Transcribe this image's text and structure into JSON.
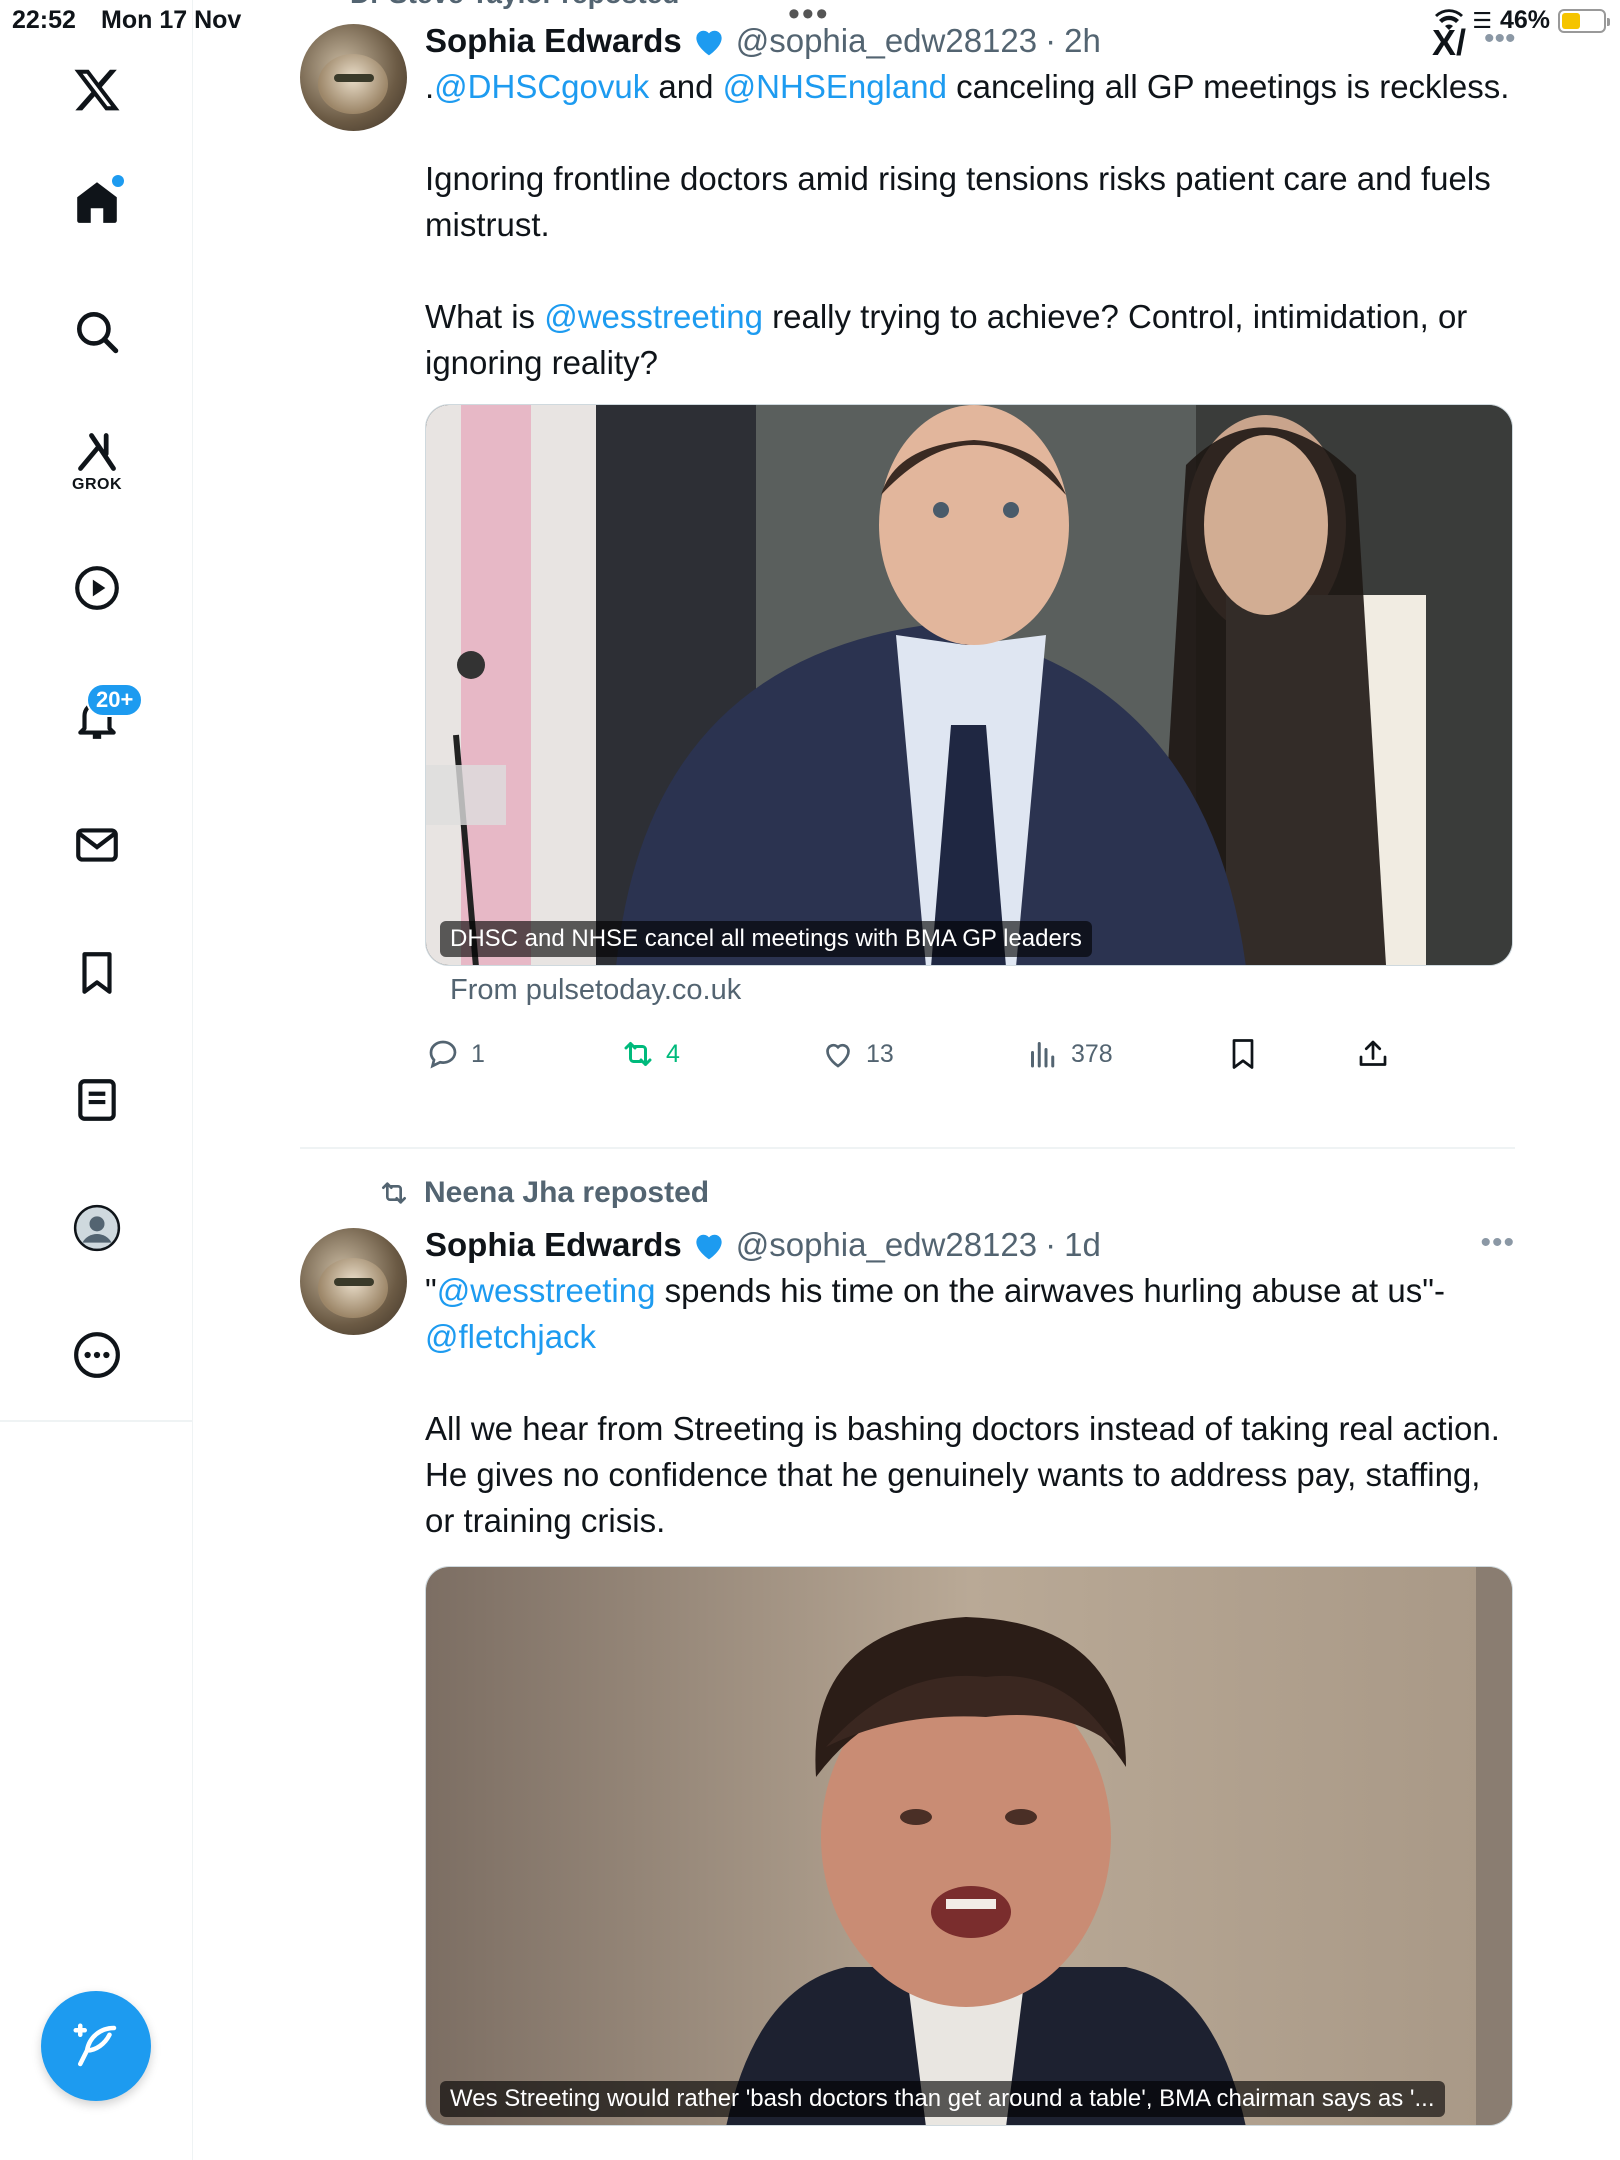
{
  "status_bar": {
    "time": "22:52",
    "date": "Mon 17 Nov",
    "battery": "46%",
    "battery_level": 0.46
  },
  "sidebar": {
    "items": [
      {
        "name": "x-logo",
        "label": ""
      },
      {
        "name": "home",
        "label": ""
      },
      {
        "name": "search",
        "label": ""
      },
      {
        "name": "grok",
        "label": "GROK"
      },
      {
        "name": "video",
        "label": ""
      },
      {
        "name": "notifications",
        "label": ""
      },
      {
        "name": "messages",
        "label": ""
      },
      {
        "name": "bookmarks",
        "label": ""
      },
      {
        "name": "lists",
        "label": ""
      },
      {
        "name": "profile",
        "label": ""
      },
      {
        "name": "more",
        "label": ""
      }
    ],
    "notification_badge": "20+"
  },
  "feed": {
    "top_repost": "Dr Steve Taylor reposted",
    "tweets": [
      {
        "author": "Sophia Edwards",
        "handle": "@sophia_edw28123",
        "time": "2h",
        "text": {
          "p1_prefix": ".",
          "p1_mention1": "@DHSCgovuk",
          "p1_and": " and ",
          "p1_mention2": "@NHSEngland",
          "p1_rest": " canceling all GP meetings is reckless.",
          "p2": "Ignoring frontline doctors amid rising tensions risks patient care and fuels mistrust.",
          "p3_prefix": "What is ",
          "p3_mention": "@wesstreeting",
          "p3_rest": " really trying to achieve? Control, intimidation, or ignoring reality?"
        },
        "media_caption": "DHSC and NHSE cancel all meetings with BMA GP leaders",
        "source": "From pulsetoday.co.uk",
        "stats": {
          "replies": "1",
          "reposts": "4",
          "likes": "13",
          "views": "378"
        }
      },
      {
        "reposted_by": "Neena Jha reposted",
        "author": "Sophia Edwards",
        "handle": "@sophia_edw28123",
        "time": "1d",
        "text": {
          "p1_quote": "\"",
          "p1_mention1": "@wesstreeting",
          "p1_rest": " spends his time on the airwaves hurling abuse at us\"-",
          "p1_mention2": "@fletchjack",
          "p2": "All we hear from Streeting is bashing doctors instead of taking real action.",
          "p3": "He gives no confidence that he genuinely wants to address pay, staffing, or training crisis."
        },
        "media_caption": "Wes Streeting would rather 'bash doctors than get around a table', BMA chairman says as '..."
      }
    ]
  },
  "colors": {
    "accent": "#1d9bf0",
    "retweet_green": "#00ba7c",
    "muted_text": "#536471"
  }
}
